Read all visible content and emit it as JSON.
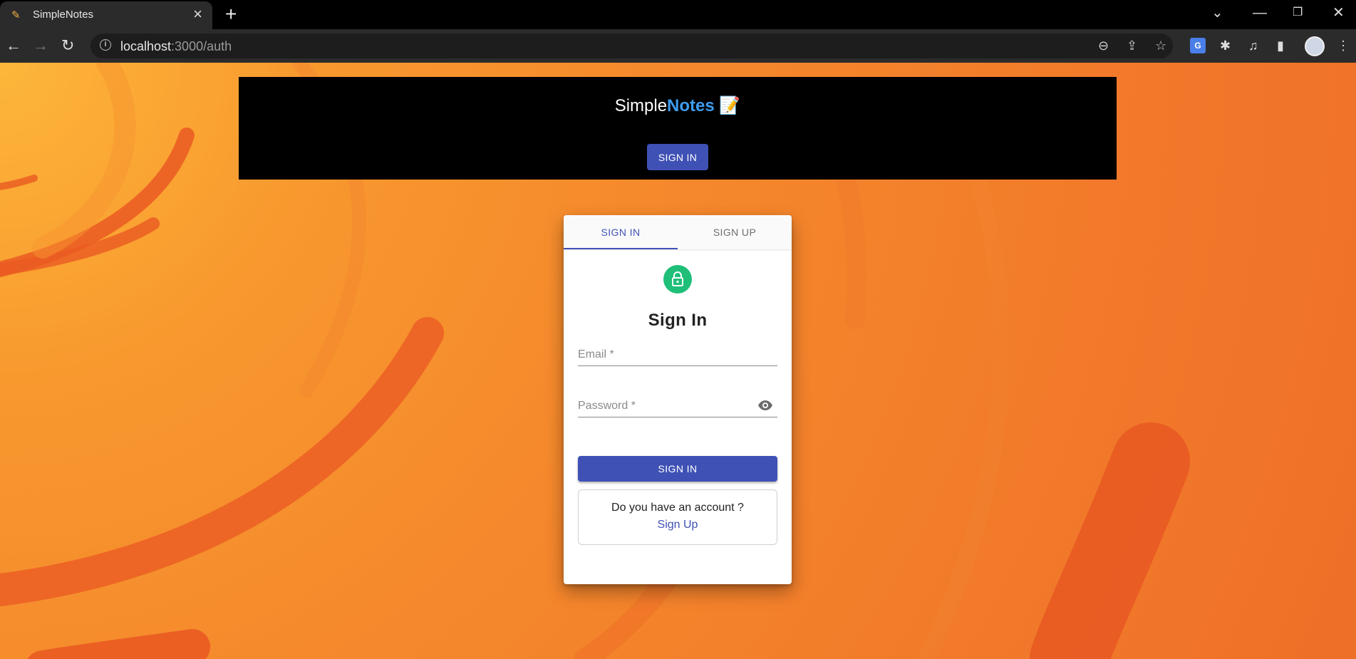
{
  "browser": {
    "tab_title": "SimpleNotes",
    "url_host": "localhost",
    "url_path": ":3000/auth"
  },
  "header": {
    "brand_simple": "Simple",
    "brand_notes": "Notes",
    "brand_emoji": "📝",
    "signin_label": "SIGN IN"
  },
  "auth": {
    "tabs": [
      {
        "label": "SIGN IN",
        "active": true
      },
      {
        "label": "SIGN UP",
        "active": false
      }
    ],
    "title": "Sign In",
    "email_label": "Email *",
    "password_label": "Password *",
    "submit_label": "SIGN IN",
    "account_question": "Do you have an account ?",
    "signup_link": "Sign Up"
  },
  "colors": {
    "primary": "#3f51b5",
    "lock_bg": "#1fbf79",
    "brand_accent": "#3d9cf0",
    "background": "#f5892c"
  },
  "icons": {
    "tab_favicon": "pencil-icon",
    "lock": "lock-icon",
    "password_toggle": "eye-icon"
  }
}
